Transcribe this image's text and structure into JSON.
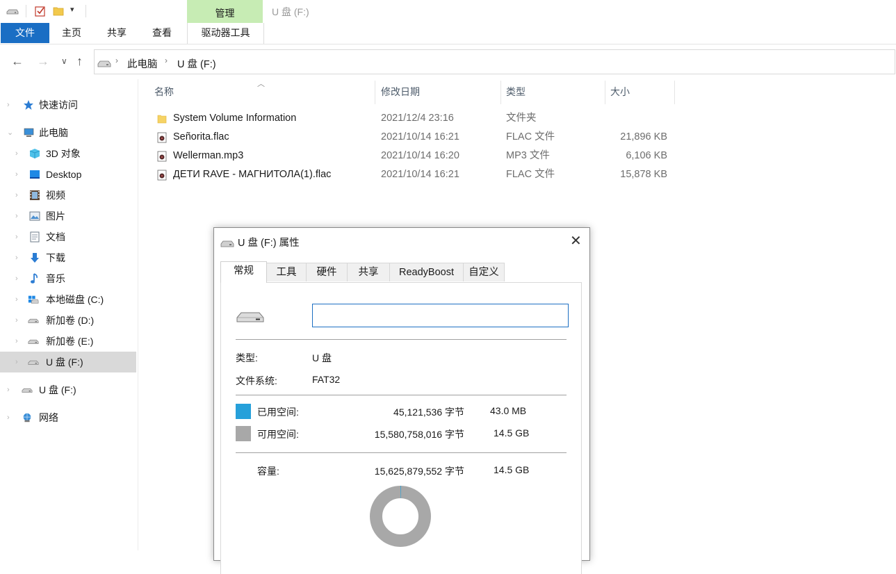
{
  "title_bar": {
    "window_title": "U 盘 (F:)",
    "context_tab_group": "管理",
    "quick_access_icons": [
      "drive-icon",
      "properties-check-icon",
      "folder-icon",
      "dropdown-arrow-icon"
    ]
  },
  "ribbon": {
    "tabs": [
      "文件",
      "主页",
      "共享",
      "查看",
      "驱动器工具"
    ],
    "active_tab": "文件",
    "colors": {
      "file_tab": "#1a6ec4",
      "context_tab": "#c7ecb4"
    }
  },
  "address_bar": {
    "breadcrumb": [
      "此电脑",
      "U 盘 (F:)"
    ]
  },
  "sidebar": {
    "items": [
      {
        "label": "快速访问",
        "icon": "star-icon"
      },
      {
        "label": "此电脑",
        "icon": "computer-icon"
      },
      {
        "label": "3D 对象",
        "icon": "cube-icon"
      },
      {
        "label": "Desktop",
        "icon": "desktop-icon"
      },
      {
        "label": "视频",
        "icon": "video-icon"
      },
      {
        "label": "图片",
        "icon": "picture-icon"
      },
      {
        "label": "文档",
        "icon": "document-icon"
      },
      {
        "label": "下载",
        "icon": "download-icon"
      },
      {
        "label": "音乐",
        "icon": "music-icon"
      },
      {
        "label": "本地磁盘 (C:)",
        "icon": "windows-drive-icon"
      },
      {
        "label": "新加卷 (D:)",
        "icon": "drive-icon"
      },
      {
        "label": "新加卷 (E:)",
        "icon": "drive-icon"
      },
      {
        "label": "U 盘 (F:)",
        "icon": "usb-drive-icon",
        "selected": true
      },
      {
        "label": "U 盘 (F:)",
        "icon": "usb-drive-icon"
      },
      {
        "label": "网络",
        "icon": "network-icon"
      }
    ]
  },
  "file_list": {
    "columns": [
      "名称",
      "修改日期",
      "类型",
      "大小"
    ],
    "rows": [
      {
        "name": "System Volume Information",
        "date": "2021/12/4 23:16",
        "type": "文件夹",
        "size": "",
        "icon": "folder-icon"
      },
      {
        "name": "Señorita.flac",
        "date": "2021/10/14 16:21",
        "type": "FLAC 文件",
        "size": "21,896 KB",
        "icon": "audio-file-icon"
      },
      {
        "name": "Wellerman.mp3",
        "date": "2021/10/14 16:20",
        "type": "MP3 文件",
        "size": "6,106 KB",
        "icon": "audio-file-icon"
      },
      {
        "name": "ДЕТИ RAVE - МАГНИТОЛА(1).flac",
        "date": "2021/10/14 16:21",
        "type": "FLAC 文件",
        "size": "15,878 KB",
        "icon": "audio-file-icon"
      }
    ]
  },
  "dialog": {
    "title": "U 盘 (F:) 属性",
    "tabs": [
      "常规",
      "工具",
      "硬件",
      "共享",
      "ReadyBoost",
      "自定义"
    ],
    "active_tab": "常规",
    "name_value": "",
    "type_label": "类型:",
    "type_value": "U 盘",
    "fs_label": "文件系统:",
    "fs_value": "FAT32",
    "used_label": "已用空间:",
    "used_bytes": "45,121,536 字节",
    "used_human": "43.0 MB",
    "free_label": "可用空间:",
    "free_bytes": "15,580,758,016 字节",
    "free_human": "14.5 GB",
    "capacity_label": "容量:",
    "capacity_bytes": "15,625,879,552 字节",
    "capacity_human": "14.5 GB",
    "used_fraction": 0.0029,
    "colors": {
      "used": "#26a0da",
      "free": "#a8a8a8"
    }
  }
}
